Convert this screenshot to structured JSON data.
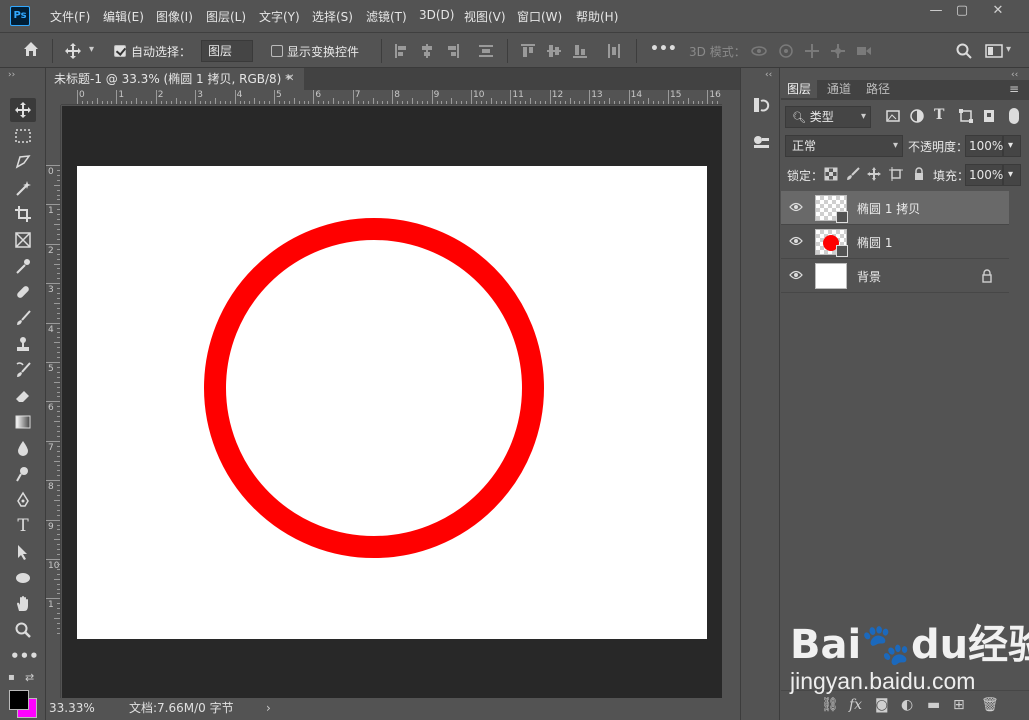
{
  "app": {
    "logo": "Ps"
  },
  "menu": [
    "文件(F)",
    "编辑(E)",
    "图像(I)",
    "图层(L)",
    "文字(Y)",
    "选择(S)",
    "滤镜(T)",
    "3D(D)",
    "视图(V)",
    "窗口(W)",
    "帮助(H)"
  ],
  "window_controls": {
    "minimize": "—",
    "maximize": "▢",
    "close": "✕"
  },
  "options": {
    "auto_select_label": "自动选择：",
    "auto_select_checked": true,
    "auto_select_target": "图层",
    "show_transform_label": "显示变换控件",
    "show_transform_checked": false,
    "more": "•••",
    "mode_3d": "3D 模式："
  },
  "document": {
    "tab_title": "未标题-1 @ 33.3% (椭圆 1 拷贝, RGB/8) *",
    "close": "✕",
    "ruler_h_labels": [
      "0",
      "1",
      "2",
      "3",
      "4",
      "5",
      "6",
      "7",
      "8",
      "9",
      "10",
      "11",
      "12",
      "13",
      "14",
      "15",
      "16"
    ],
    "ruler_v_labels": [
      "0",
      "1",
      "2",
      "3",
      "4",
      "5",
      "6",
      "7",
      "8",
      "9",
      "10",
      "1"
    ],
    "zoom": "33.33%",
    "doc_info": "文档:7.66M/0 字节",
    "ring_color": "#ff0000"
  },
  "tools": [
    "move-tool",
    "marquee-tool",
    "lasso-tool",
    "magic-wand-tool",
    "crop-tool",
    "frame-tool",
    "eyedropper-tool",
    "healing-brush-tool",
    "brush-tool",
    "stamp-tool",
    "history-brush-tool",
    "eraser-tool",
    "gradient-tool",
    "blur-tool",
    "dodge-tool",
    "pen-tool",
    "type-tool",
    "path-select-tool",
    "ellipse-tool",
    "hand-tool",
    "zoom-tool",
    "more-tools"
  ],
  "colors": {
    "foreground": "#000000",
    "background": "#ff00ff"
  },
  "layers_panel": {
    "tabs": [
      "图层",
      "通道",
      "路径"
    ],
    "active_tab": "图层",
    "filter_label": "类型",
    "blend_mode": "正常",
    "opacity_label": "不透明度：",
    "opacity_value": "100%",
    "lock_label": "锁定：",
    "fill_label": "填充：",
    "fill_value": "100%",
    "layers": [
      {
        "name": "椭圆 1 拷贝",
        "selected": true,
        "thumb": "transparent"
      },
      {
        "name": "椭圆 1",
        "selected": false,
        "thumb": "red-shape"
      },
      {
        "name": "背景",
        "selected": false,
        "thumb": "white",
        "locked": true
      }
    ]
  },
  "watermark": {
    "logo_text": "Bai🐾du经验",
    "url": "jingyan.baidu.com"
  }
}
